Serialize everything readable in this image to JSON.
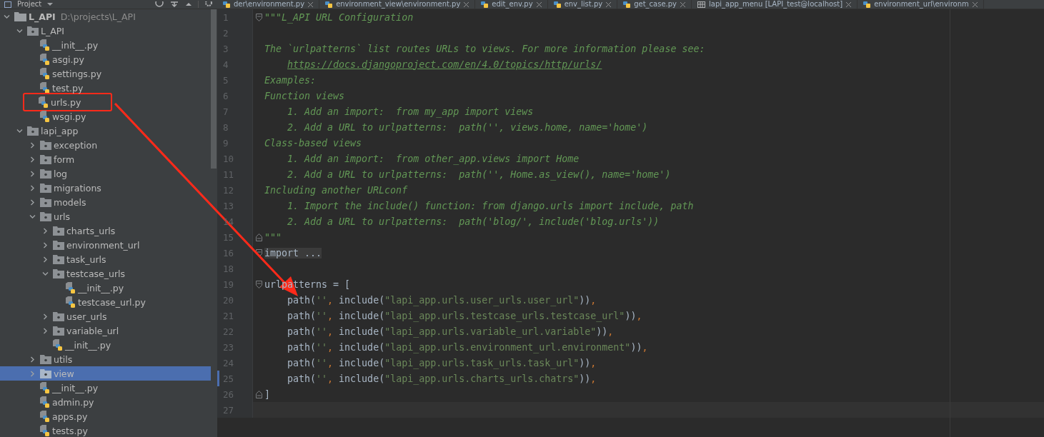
{
  "project_panel": {
    "title": "Project"
  },
  "editor_tabs": [
    {
      "label": "der\\environment.py",
      "kind": "python",
      "selected": false
    },
    {
      "label": "environment_view\\environment.py",
      "kind": "python",
      "selected": false
    },
    {
      "label": "edit_env.py",
      "kind": "python",
      "selected": false
    },
    {
      "label": "env_list.py",
      "kind": "python",
      "selected": false
    },
    {
      "label": "get_case.py",
      "kind": "python",
      "selected": false
    },
    {
      "label": "lapi_app_menu [LAPI_test@localhost]",
      "kind": "table",
      "selected": false
    },
    {
      "label": "environment_url\\environm",
      "kind": "python",
      "selected": false
    }
  ],
  "tree": [
    {
      "name": "L_API",
      "path": "D:\\projects\\L_API",
      "kind": "root",
      "expanded": true,
      "selected": false,
      "children": [
        {
          "name": "L_API",
          "kind": "package",
          "expanded": true,
          "selected": false,
          "children": [
            {
              "name": "__init__.py",
              "kind": "file",
              "selected": false
            },
            {
              "name": "asgi.py",
              "kind": "file",
              "selected": false
            },
            {
              "name": "settings.py",
              "kind": "file",
              "selected": false
            },
            {
              "name": "test.py",
              "kind": "file",
              "selected": false
            },
            {
              "name": "urls.py",
              "kind": "file",
              "selected": false,
              "highlighted": true
            },
            {
              "name": "wsgi.py",
              "kind": "file",
              "selected": false
            }
          ]
        },
        {
          "name": "lapi_app",
          "kind": "package",
          "expanded": true,
          "selected": false,
          "children": [
            {
              "name": "exception",
              "kind": "package",
              "expanded": false,
              "selected": false
            },
            {
              "name": "form",
              "kind": "package",
              "expanded": false,
              "selected": false
            },
            {
              "name": "log",
              "kind": "package",
              "expanded": false,
              "selected": false
            },
            {
              "name": "migrations",
              "kind": "package",
              "expanded": false,
              "selected": false
            },
            {
              "name": "models",
              "kind": "package",
              "expanded": false,
              "selected": false
            },
            {
              "name": "urls",
              "kind": "package",
              "expanded": true,
              "selected": false,
              "children": [
                {
                  "name": "charts_urls",
                  "kind": "package",
                  "expanded": false,
                  "selected": false
                },
                {
                  "name": "environment_url",
                  "kind": "package",
                  "expanded": false,
                  "selected": false
                },
                {
                  "name": "task_urls",
                  "kind": "package",
                  "expanded": false,
                  "selected": false
                },
                {
                  "name": "testcase_urls",
                  "kind": "package",
                  "expanded": true,
                  "selected": false,
                  "children": [
                    {
                      "name": "__init__.py",
                      "kind": "file",
                      "selected": false
                    },
                    {
                      "name": "testcase_url.py",
                      "kind": "file",
                      "selected": false
                    }
                  ]
                },
                {
                  "name": "user_urls",
                  "kind": "package",
                  "expanded": false,
                  "selected": false
                },
                {
                  "name": "variable_url",
                  "kind": "package",
                  "expanded": false,
                  "selected": false
                },
                {
                  "name": "__init__.py",
                  "kind": "file",
                  "selected": false
                }
              ]
            },
            {
              "name": "utils",
              "kind": "package",
              "expanded": false,
              "selected": false
            },
            {
              "name": "view",
              "kind": "package",
              "expanded": false,
              "selected": true
            },
            {
              "name": "__init__.py",
              "kind": "file",
              "selected": false
            },
            {
              "name": "admin.py",
              "kind": "file",
              "selected": false
            },
            {
              "name": "apps.py",
              "kind": "file",
              "selected": false
            },
            {
              "name": "tests.py",
              "kind": "file",
              "selected": false
            }
          ]
        }
      ]
    }
  ],
  "code_lines": [
    {
      "number": "1",
      "fold_start": true,
      "tokens": [
        {
          "kind": "doc",
          "text": "\"\"\"L_API URL Configuration"
        }
      ]
    },
    {
      "number": "2"
    },
    {
      "number": "3",
      "tokens": [
        {
          "kind": "doc",
          "text": "The `urlpatterns` list routes URLs to views. For more information please see:"
        }
      ]
    },
    {
      "number": "4",
      "indented": true,
      "tokens": [
        {
          "kind": "link",
          "text": "https://docs.djangoproject.com/en/4.0/topics/http/urls/"
        }
      ]
    },
    {
      "number": "5",
      "tokens": [
        {
          "kind": "doc",
          "text": "Examples:"
        }
      ]
    },
    {
      "number": "6",
      "tokens": [
        {
          "kind": "doc",
          "text": "Function views"
        }
      ]
    },
    {
      "number": "7",
      "tokens": [
        {
          "kind": "doc",
          "text": "    1. Add an import:  from my_app import views"
        }
      ]
    },
    {
      "number": "8",
      "tokens": [
        {
          "kind": "doc",
          "text": "    2. Add a URL to urlpatterns:  path('', views.home, name='home')"
        }
      ]
    },
    {
      "number": "9",
      "tokens": [
        {
          "kind": "doc",
          "text": "Class-based views"
        }
      ]
    },
    {
      "number": "10",
      "tokens": [
        {
          "kind": "doc",
          "text": "    1. Add an import:  from other_app.views import Home"
        }
      ]
    },
    {
      "number": "11",
      "tokens": [
        {
          "kind": "doc",
          "text": "    2. Add a URL to urlpatterns:  path('', Home.as_view(), name='home')"
        }
      ]
    },
    {
      "number": "12",
      "tokens": [
        {
          "kind": "doc",
          "text": "Including another URLconf"
        }
      ]
    },
    {
      "number": "13",
      "tokens": [
        {
          "kind": "doc",
          "text": "    1. Import the include() function: from django.urls import include, path"
        }
      ]
    },
    {
      "number": "14",
      "tokens": [
        {
          "kind": "doc",
          "text": "    2. Add a URL to urlpatterns:  path('blog/', include('blog.urls'))"
        }
      ]
    },
    {
      "number": "15",
      "fold_end": true,
      "tokens": [
        {
          "kind": "doc",
          "text": "\"\"\""
        }
      ]
    },
    {
      "number": "16",
      "fold_start": true,
      "tokens": [
        {
          "kind": "folded",
          "text": "import ..."
        }
      ]
    },
    {
      "number": "18"
    },
    {
      "number": "19",
      "fold_start": true,
      "tokens": [
        {
          "kind": "plain",
          "text": "urlpatterns = ["
        }
      ]
    },
    {
      "number": "20",
      "tokens": [
        {
          "kind": "plain",
          "text": "    path("
        },
        {
          "kind": "str",
          "text": "''"
        },
        {
          "kind": "punct",
          "text": ", "
        },
        {
          "kind": "plain",
          "text": "include("
        },
        {
          "kind": "str",
          "text": "\"lapi_app.urls.user_urls.user_url\""
        },
        {
          "kind": "plain",
          "text": "))"
        },
        {
          "kind": "punct",
          "text": ","
        }
      ]
    },
    {
      "number": "21",
      "tokens": [
        {
          "kind": "plain",
          "text": "    path("
        },
        {
          "kind": "str",
          "text": "''"
        },
        {
          "kind": "punct",
          "text": ", "
        },
        {
          "kind": "plain",
          "text": "include("
        },
        {
          "kind": "str",
          "text": "\"lapi_app.urls.testcase_urls.testcase_url\""
        },
        {
          "kind": "plain",
          "text": "))"
        },
        {
          "kind": "punct",
          "text": ","
        }
      ]
    },
    {
      "number": "22",
      "tokens": [
        {
          "kind": "plain",
          "text": "    path("
        },
        {
          "kind": "str",
          "text": "''"
        },
        {
          "kind": "punct",
          "text": ", "
        },
        {
          "kind": "plain",
          "text": "include("
        },
        {
          "kind": "str",
          "text": "\"lapi_app.urls.variable_url.variable\""
        },
        {
          "kind": "plain",
          "text": "))"
        },
        {
          "kind": "punct",
          "text": ","
        }
      ]
    },
    {
      "number": "23",
      "tokens": [
        {
          "kind": "plain",
          "text": "    path("
        },
        {
          "kind": "str",
          "text": "''"
        },
        {
          "kind": "punct",
          "text": ", "
        },
        {
          "kind": "plain",
          "text": "include("
        },
        {
          "kind": "str",
          "text": "\"lapi_app.urls.environment_url.environment\""
        },
        {
          "kind": "plain",
          "text": "))"
        },
        {
          "kind": "punct",
          "text": ","
        }
      ]
    },
    {
      "number": "24",
      "tokens": [
        {
          "kind": "plain",
          "text": "    path("
        },
        {
          "kind": "str",
          "text": "''"
        },
        {
          "kind": "punct",
          "text": ", "
        },
        {
          "kind": "plain",
          "text": "include("
        },
        {
          "kind": "str",
          "text": "\"lapi_app.urls.task_urls.task_url\""
        },
        {
          "kind": "plain",
          "text": "))"
        },
        {
          "kind": "punct",
          "text": ","
        }
      ]
    },
    {
      "number": "25",
      "changed": true,
      "tokens": [
        {
          "kind": "plain",
          "text": "    path("
        },
        {
          "kind": "str",
          "text": "''"
        },
        {
          "kind": "punct",
          "text": ", "
        },
        {
          "kind": "plain",
          "text": "include("
        },
        {
          "kind": "str",
          "text": "\"lapi_app.urls.charts_urls.chatrs\""
        },
        {
          "kind": "plain",
          "text": "))"
        },
        {
          "kind": "punct",
          "text": ","
        }
      ]
    },
    {
      "number": "26",
      "fold_end": true,
      "tokens": [
        {
          "kind": "plain",
          "text": "]"
        }
      ]
    },
    {
      "number": "27",
      "current": true
    }
  ],
  "annotations": [
    {
      "kind": "arrow"
    }
  ]
}
